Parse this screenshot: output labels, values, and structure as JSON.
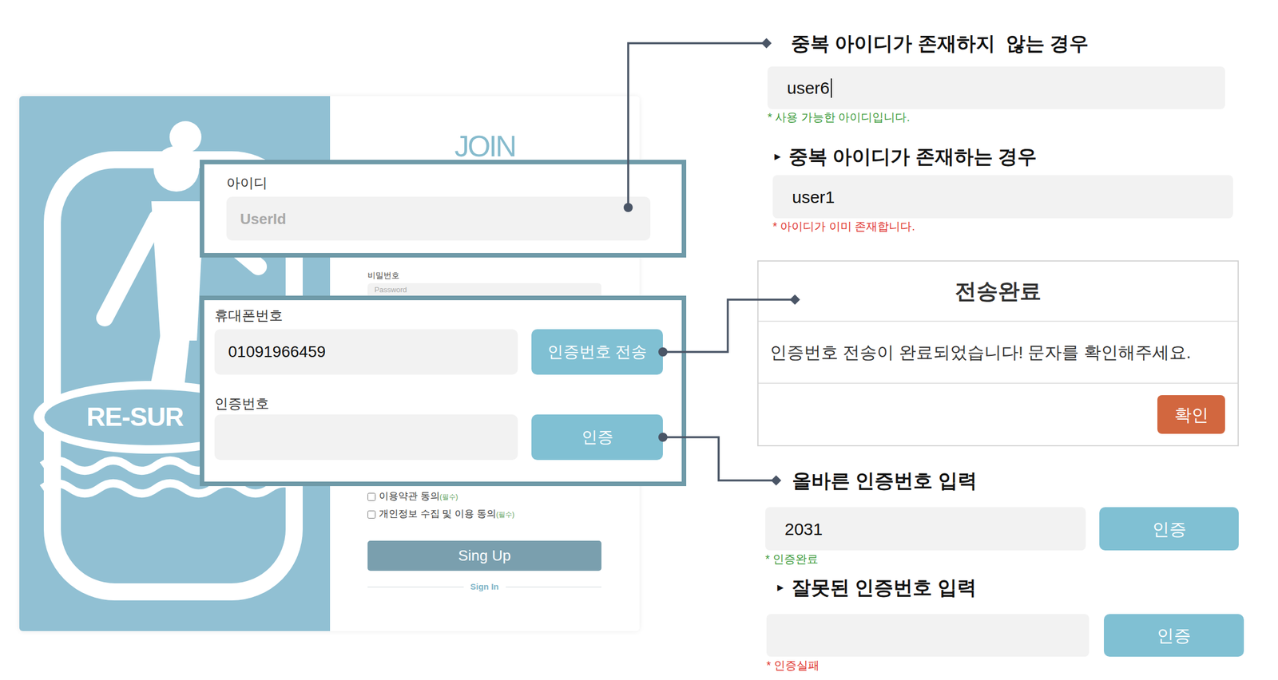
{
  "signup_form": {
    "logo_text": "RE-SUR",
    "title": "JOIN",
    "id_field": {
      "label": "아이디",
      "placeholder": "UserId"
    },
    "password_field": {
      "label": "비밀번호",
      "placeholder": "Password"
    },
    "phone_field": {
      "label": "휴대폰번호",
      "value": "01091966459",
      "button": "인증번호 전송"
    },
    "code_field": {
      "label": "인증번호",
      "button": "인증"
    },
    "agreements": [
      {
        "label": "이용약관 동의",
        "tag": "(필수)",
        "checked": false
      },
      {
        "label": "개인정보 수집 및 이용 동의",
        "tag": "(필수)",
        "checked": false
      }
    ],
    "submit_button": "Sing Up",
    "signin_link": "Sign In"
  },
  "id_cases": [
    {
      "title": "중복 아이디가 존재하지  않는 경우",
      "value": "user6",
      "focused": true,
      "message": "* 사용 가능한 아이디입니다.",
      "color": "#3a9a3a"
    },
    {
      "marker": "▸",
      "title": "중복 아이디가 존재하는 경우",
      "value": "user1",
      "focused": false,
      "message": "* 아이디가 이미 존재합니다.",
      "color": "#e0342e"
    }
  ],
  "send_dialog": {
    "title": "전송완료",
    "message": "인증번호 전송이 완료되었습니다! 문자를 확인해주세요.",
    "button": "확인"
  },
  "code_cases": [
    {
      "title": "올바른 인증번호 입력",
      "value": "2031",
      "button": "인증",
      "message": "* 인증완료",
      "color": "#3a9a3a"
    },
    {
      "marker": "▸",
      "title": "잘못된 인증번호 입력",
      "value": "",
      "button": "인증",
      "message": "* 인증실패",
      "color": "#e0342e"
    }
  ]
}
